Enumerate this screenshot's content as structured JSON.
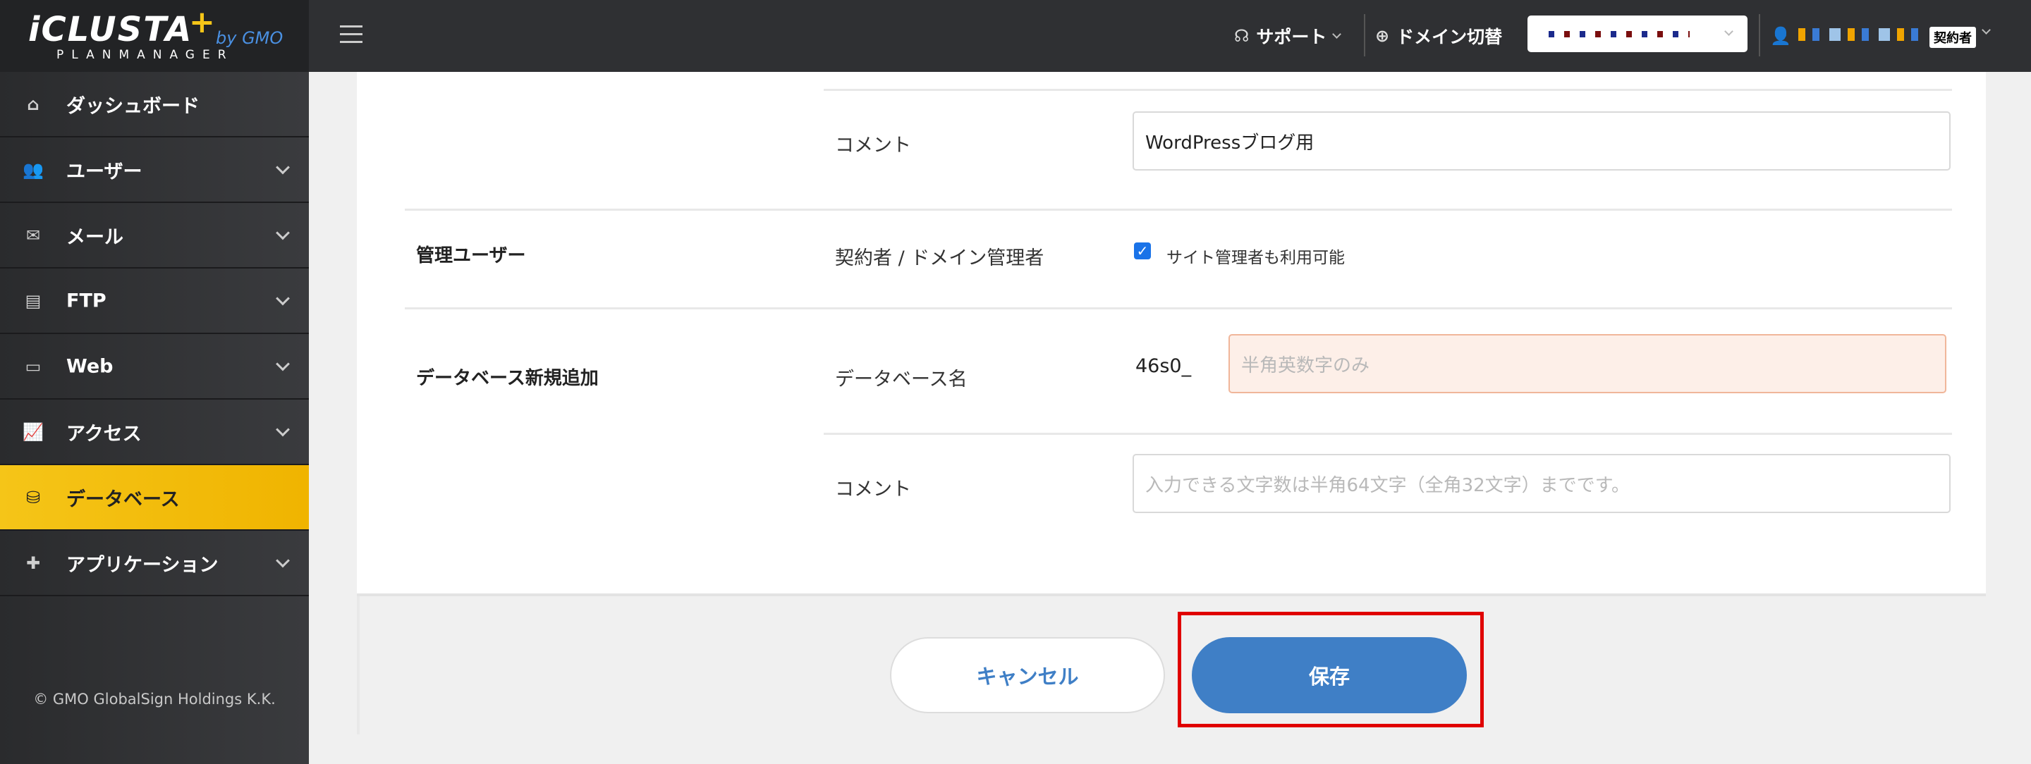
{
  "logo": {
    "main": "iCLUSTA",
    "plus": "+",
    "by": "by GMO",
    "sub": "PLANMANAGER"
  },
  "sidebar": {
    "items": [
      {
        "label": "ダッシュボード",
        "icon": "home-icon",
        "expandable": false,
        "active": false
      },
      {
        "label": "ユーザー",
        "icon": "users-icon",
        "expandable": true,
        "active": false
      },
      {
        "label": "メール",
        "icon": "mail-icon",
        "expandable": true,
        "active": false
      },
      {
        "label": "FTP",
        "icon": "file-icon",
        "expandable": true,
        "active": false
      },
      {
        "label": "Web",
        "icon": "window-icon",
        "expandable": true,
        "active": false
      },
      {
        "label": "アクセス",
        "icon": "chart-icon",
        "expandable": true,
        "active": false
      },
      {
        "label": "データベース",
        "icon": "database-icon",
        "expandable": false,
        "active": true
      },
      {
        "label": "アプリケーション",
        "icon": "puzzle-icon",
        "expandable": true,
        "active": false
      }
    ],
    "copyright": "© GMO GlobalSign Holdings K.K."
  },
  "topbar": {
    "support_label": "サポート",
    "domain_switch_label": "ドメイン切替",
    "role_badge": "契約者"
  },
  "form": {
    "comment_label_1": "コメント",
    "comment_value_1": "WordPressブログ用",
    "admin_section": "管理ユーザー",
    "admin_field_label": "契約者 / ドメイン管理者",
    "admin_checkbox_label": "サイト管理者も利用可能",
    "admin_checkbox_checked": true,
    "db_section": "データベース新規追加",
    "db_name_label": "データベース名",
    "db_prefix": "46s0_",
    "db_name_placeholder": "半角英数字のみ",
    "comment_label_2": "コメント",
    "comment_placeholder_2": "入力できる文字数は半角64文字（全角32文字）までです。"
  },
  "buttons": {
    "cancel": "キャンセル",
    "save": "保存"
  },
  "colors": {
    "accent": "#f5c518",
    "primary": "#3f7fc6",
    "highlight": "#e00000",
    "error_bg": "#fdefe8"
  }
}
